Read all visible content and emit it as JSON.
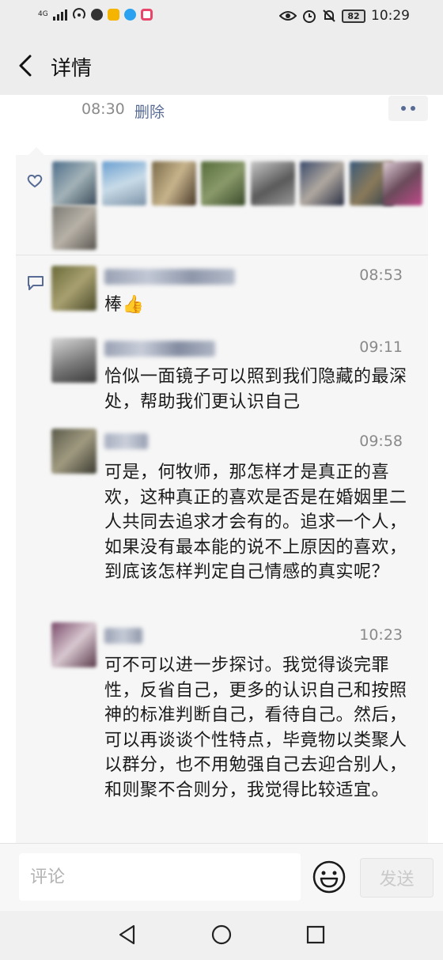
{
  "status_bar": {
    "network": "4G",
    "time": "10:29",
    "battery": "82"
  },
  "header": {
    "title": "详情"
  },
  "post": {
    "time": "08:30",
    "delete_label": "删除"
  },
  "comments": [
    {
      "time": "08:53",
      "text": "棒",
      "emoji": "👍"
    },
    {
      "time": "09:11",
      "text": "恰似一面镜子可以照到我们隐藏的最深处，帮助我们更认识自己"
    },
    {
      "time": "09:58",
      "text": "可是，何牧师，那怎样才是真正的喜欢，这种真正的喜欢是否是在婚姻里二人共同去追求才会有的。追求一个人，如果没有最本能的说不上原因的喜欢，到底该怎样判定自己情感的真实呢？"
    },
    {
      "time": "10:23",
      "text": "可不可以进一步探讨。我觉得谈完罪性，反省自己，更多的认识自己和按照神的标准判断自己，看待自己。然后，可以再谈谈个性特点，毕竟物以类聚人以群分，也不用勉强自己去迎合别人，和则聚不合则分，我觉得比较适宜。"
    }
  ],
  "input_bar": {
    "placeholder": "评论",
    "send_label": "发送"
  },
  "colors": {
    "link": "#576b95",
    "meta_gray": "#8a8a8a",
    "panel": "#f6f6f6",
    "header_bg": "#ededed"
  }
}
